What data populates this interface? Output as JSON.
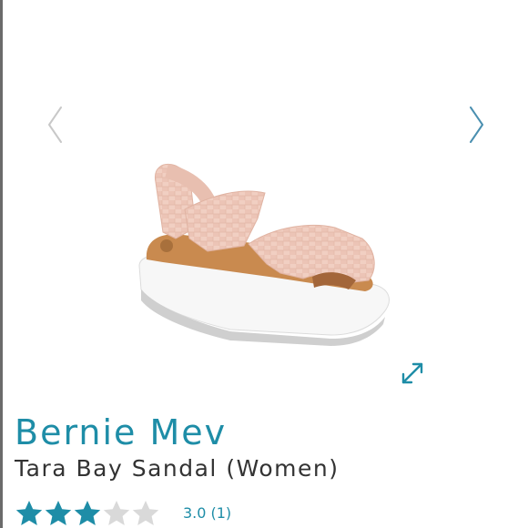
{
  "carousel": {
    "prev_icon": "chevron-left-icon",
    "next_icon": "chevron-right-icon",
    "expand_icon": "expand-icon"
  },
  "product": {
    "brand": "Bernie Mev",
    "name": "Tara Bay Sandal (Women)",
    "image_description_icon": "sandal-image"
  },
  "rating": {
    "stars_filled": 3,
    "stars_total": 5,
    "score": "3.0",
    "count": "(1)"
  },
  "colors": {
    "accent": "#1e8da7",
    "star_filled": "#1e8da7",
    "star_empty": "#d9d9d9",
    "arrow_prev": "#c8c8c8",
    "arrow_next": "#4a8fb0"
  }
}
